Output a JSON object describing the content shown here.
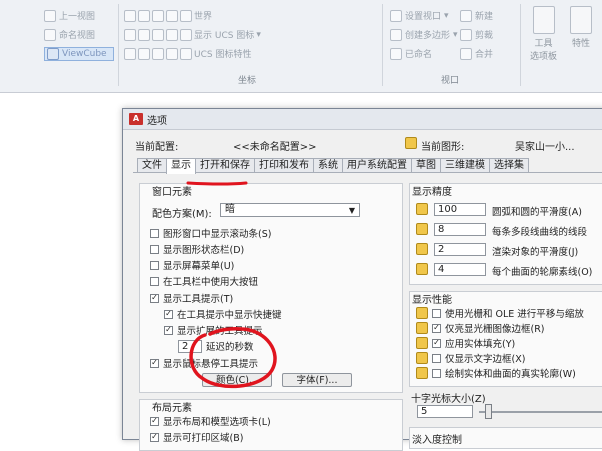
{
  "ribbon": {
    "view_items": [
      "上一视图",
      "命名视图",
      "ViewCube"
    ],
    "coords": {
      "world": "世界",
      "ucs_icon": "显示 UCS 图标",
      "ucs_props": "UCS 图标特性",
      "group_label": "坐标"
    },
    "viewport": {
      "set_viewport": "设置视口",
      "new": "新建",
      "create_polygon": "创建多边形",
      "clip": "剪裁",
      "named": "已命名",
      "merge": "合并",
      "group_label": "视口"
    },
    "tools": {
      "tool_palette": "工具\n选项板",
      "props": "特性"
    }
  },
  "dialog": {
    "title": "选项",
    "current_profile_label": "当前配置:",
    "current_profile_value": "<<未命名配置>>",
    "current_drawing_label": "当前图形:",
    "current_drawing_value": "吴家山一小...",
    "tabs": [
      "文件",
      "显示",
      "打开和保存",
      "打印和发布",
      "系统",
      "用户系统配置",
      "草图",
      "三维建模",
      "选择集"
    ],
    "window_elements": {
      "title": "窗口元素",
      "color_scheme_label": "配色方案(M):",
      "color_scheme_value": "暗",
      "checkboxes": [
        {
          "label": "图形窗口中显示滚动条(S)",
          "checked": false
        },
        {
          "label": "显示图形状态栏(D)",
          "checked": false
        },
        {
          "label": "显示屏幕菜单(U)",
          "checked": false
        },
        {
          "label": "在工具栏中使用大按钮",
          "checked": false
        },
        {
          "label": "显示工具提示(T)",
          "checked": true
        },
        {
          "label": "在工具提示中显示快捷键",
          "checked": true
        },
        {
          "label": "显示扩展的工具提示",
          "checked": true
        },
        {
          "label": "延迟的秒数",
          "checked": false
        },
        {
          "label": "显示鼠标悬停工具提示",
          "checked": true
        }
      ],
      "delay_value": "2",
      "color_button": "颜色(C)...",
      "font_button": "字体(F)..."
    },
    "layout_elements": {
      "title": "布局元素",
      "checkboxes": [
        {
          "label": "显示布局和模型选项卡(L)",
          "checked": true
        },
        {
          "label": "显示可打印区域(B)",
          "checked": true
        }
      ]
    },
    "display_resolution": {
      "title": "显示精度",
      "rows": [
        {
          "value": "100",
          "label": "圆弧和圆的平滑度(A)"
        },
        {
          "value": "8",
          "label": "每条多段线曲线的线段"
        },
        {
          "value": "2",
          "label": "渲染对象的平滑度(J)"
        },
        {
          "value": "4",
          "label": "每个曲面的轮廓素线(O)"
        }
      ]
    },
    "display_performance": {
      "title": "显示性能",
      "checkboxes": [
        {
          "label": "使用光栅和 OLE 进行平移与缩放",
          "checked": false
        },
        {
          "label": "仅亮显光栅图像边框(R)",
          "checked": true
        },
        {
          "label": "应用实体填充(Y)",
          "checked": true
        },
        {
          "label": "仅显示文字边框(X)",
          "checked": false
        },
        {
          "label": "绘制实体和曲面的真实轮廓(W)",
          "checked": false
        }
      ]
    },
    "crosshair": {
      "title": "十字光标大小(Z)",
      "value": "5",
      "level": 0.05
    },
    "fade": {
      "title": "淡入度控制"
    }
  },
  "annotation": {
    "color": "#e0141e"
  }
}
